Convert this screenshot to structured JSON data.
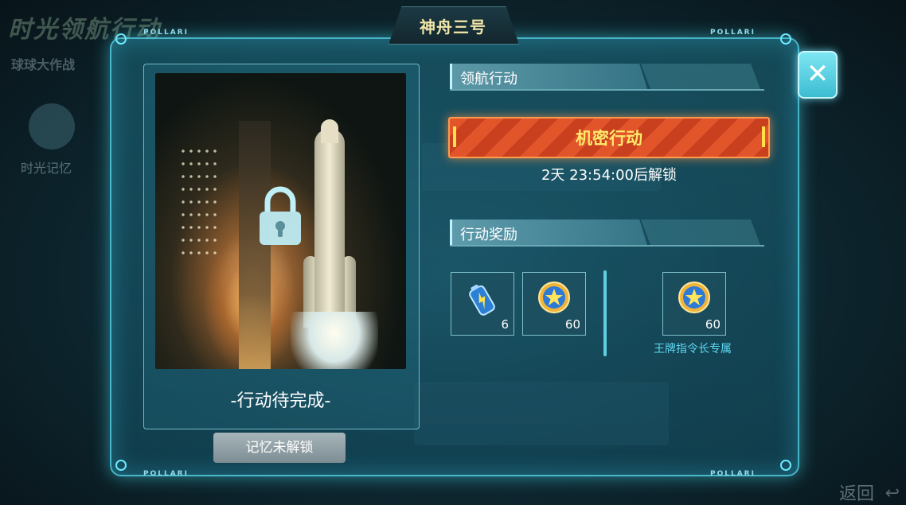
{
  "background": {
    "title": "时光领航行动",
    "subtitle": "球球大作战",
    "side_label": "时光记忆",
    "back_label": "返回"
  },
  "dialog": {
    "title": "神舟三号",
    "brand_text": "POLLARI",
    "close_icon": "close-icon"
  },
  "memory_card": {
    "status": "-行动待完成-",
    "lock_icon": "lock-icon",
    "unlock_button": "记忆未解锁"
  },
  "mission": {
    "header": "领航行动",
    "action_label": "机密行动",
    "countdown": "2天 23:54:00后解锁"
  },
  "rewards": {
    "header": "行动奖励",
    "items": [
      {
        "icon": "energy-battery-icon",
        "count": "6"
      },
      {
        "icon": "star-badge-icon",
        "count": "60"
      }
    ],
    "exclusive": {
      "icon": "star-badge-icon",
      "count": "60",
      "label": "王牌指令长专属"
    }
  },
  "colors": {
    "accent": "#6fe9ff",
    "action": "#e2542a",
    "action_text": "#ffe96a",
    "exclusive_text": "#5fd8f2"
  }
}
